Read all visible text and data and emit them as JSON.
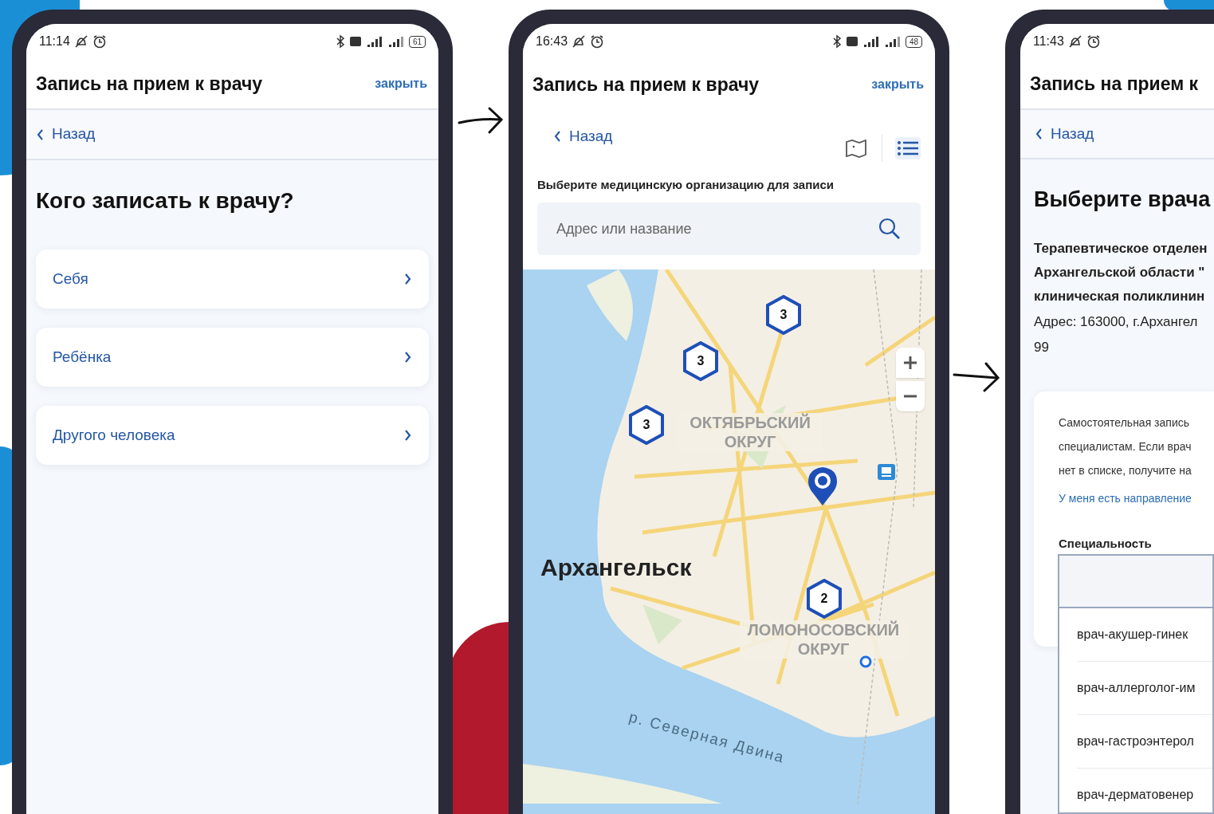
{
  "phones": [
    {
      "kind": "who",
      "status": {
        "time": "11:14",
        "battery": "61"
      },
      "header": {
        "title": "Запись на прием к врачу",
        "close": "закрыть"
      },
      "back": "Назад",
      "heading": "Кого записать к врачу?",
      "options": [
        "Себя",
        "Ребёнка",
        "Другого человека"
      ]
    },
    {
      "kind": "map",
      "status": {
        "time": "16:43",
        "battery": "48"
      },
      "header": {
        "title": "Запись на прием к врачу",
        "close": "закрыть"
      },
      "back": "Назад",
      "views": [
        {
          "kind": "map",
          "selected": false
        },
        {
          "kind": "list",
          "selected": true
        }
      ],
      "label": "Выберите медицинскую организацию для записи",
      "search": {
        "placeholder": "Адрес или название"
      },
      "map": {
        "labels": [
          {
            "kind": "district",
            "text": "ОКТЯБРЬСКИЙ ОКРУГ"
          },
          {
            "kind": "city",
            "text": "Архангельск"
          },
          {
            "kind": "district",
            "text": "ЛОМОНОСОВСКИЙ ОКРУГ"
          },
          {
            "kind": "river",
            "text": "р. Северная Двина"
          }
        ],
        "clusters": [
          "3",
          "3",
          "3",
          "2"
        ]
      }
    },
    {
      "kind": "doctor",
      "status": {
        "time": "11:43"
      },
      "header": {
        "title": "Запись на прием к "
      },
      "back": "Назад",
      "heading": "Выберите врача",
      "org_lines": [
        "Терапевтическое отделен",
        "Архангельской области \"",
        "клиническая поликлинин"
      ],
      "address_lines": [
        "Адрес: 163000, г.Архангел",
        "99"
      ],
      "notice_lines": [
        "Самостоятельная запись",
        "специалистам. Если врач",
        "нет в списке, получите на"
      ],
      "link": "У меня есть направление",
      "field_label": "Специальность",
      "specialties": [
        "врач-акушер-гинек",
        "врач-аллерголог-им",
        "врач-гастроэнтерол",
        "врач-дерматовенер"
      ]
    }
  ]
}
